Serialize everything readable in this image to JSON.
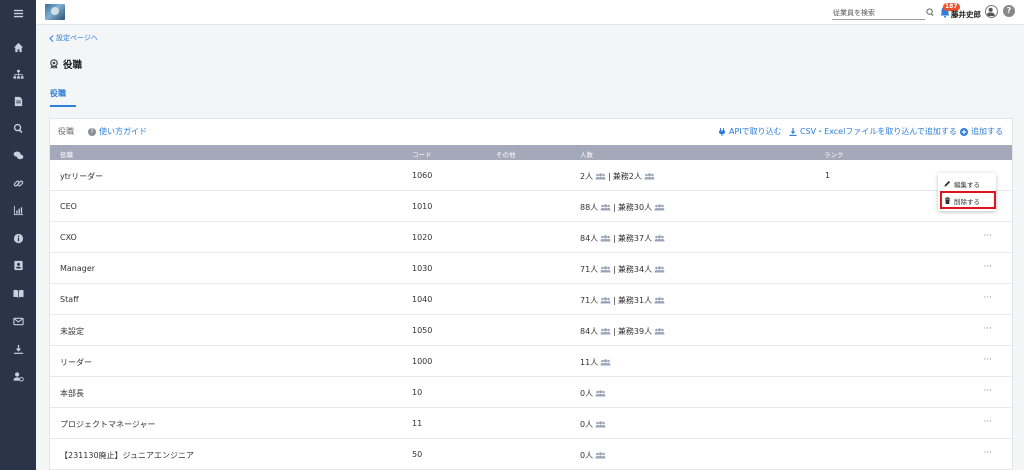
{
  "header": {
    "search_placeholder": "従業員を検索",
    "badge_count": "187",
    "user_name": "藤井史郎",
    "help_label": "?"
  },
  "sidebar": {
    "icons": [
      "menu-icon",
      "home-icon",
      "org-chart-icon",
      "document-icon",
      "search-icon",
      "chat-icon",
      "link-icon",
      "chart-icon",
      "info-icon",
      "contact-card-icon",
      "book-icon",
      "mail-icon",
      "download-icon",
      "user-settings-icon"
    ]
  },
  "breadcrumb": {
    "back_label": "設定ページへ"
  },
  "page": {
    "title": "役職"
  },
  "tabs": [
    {
      "label": "役職"
    }
  ],
  "card": {
    "title": "役職",
    "guide_label": "使い方ガイド",
    "api_label": "APIで取り込む",
    "csv_label": "CSV・Excelファイルを取り込んで追加する",
    "add_label": "追加する"
  },
  "table": {
    "columns": [
      "役職",
      "コード",
      "その他",
      "人数",
      "ランク"
    ],
    "rows": [
      {
        "name": "ytrリーダー",
        "code": "1060",
        "count": "2人",
        "concurrent": "兼務2人",
        "rank": "1"
      },
      {
        "name": "CEO",
        "code": "1010",
        "count": "88人",
        "concurrent": "兼務30人",
        "rank": ""
      },
      {
        "name": "CXO",
        "code": "1020",
        "count": "84人",
        "concurrent": "兼務37人",
        "rank": ""
      },
      {
        "name": "Manager",
        "code": "1030",
        "count": "71人",
        "concurrent": "兼務34人",
        "rank": ""
      },
      {
        "name": "Staff",
        "code": "1040",
        "count": "71人",
        "concurrent": "兼務31人",
        "rank": ""
      },
      {
        "name": "未設定",
        "code": "1050",
        "count": "84人",
        "concurrent": "兼務39人",
        "rank": ""
      },
      {
        "name": "リーダー",
        "code": "1000",
        "count": "11人",
        "concurrent": "",
        "rank": ""
      },
      {
        "name": "本部長",
        "code": "10",
        "count": "0人",
        "concurrent": "",
        "rank": ""
      },
      {
        "name": "プロジェクトマネージャー",
        "code": "11",
        "count": "0人",
        "concurrent": "",
        "rank": ""
      },
      {
        "name": "【231130廃止】ジュニアエンジニア",
        "code": "50",
        "count": "0人",
        "concurrent": "",
        "rank": ""
      }
    ]
  },
  "row_menu": {
    "edit_label": "編集する",
    "delete_label": "削除する"
  },
  "colors": {
    "sidebar_bg": "#2b3448",
    "accent": "#2e7fd9",
    "table_header_bg": "#a5a8b8",
    "highlight": "#e0141d",
    "badge": "#e8532f"
  }
}
